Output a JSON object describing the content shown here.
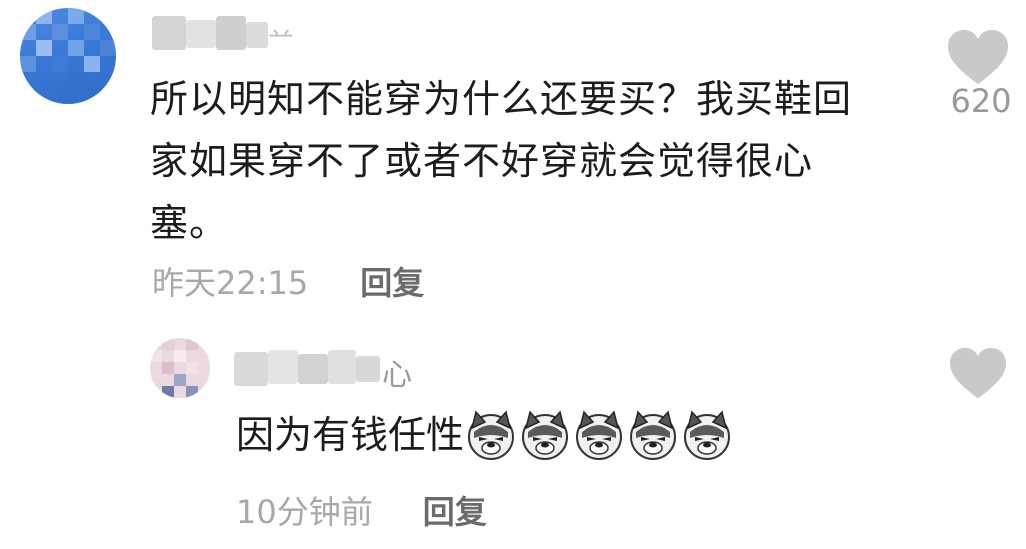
{
  "comment": {
    "username_suffix": "䒑",
    "text": "所以明知不能穿为什么还要买？我买鞋回家如果穿不了或者不好穿就会觉得很心塞。",
    "like_count": "620",
    "time": "昨天22:15",
    "reply_label": "回复"
  },
  "reply": {
    "username_suffix": "心",
    "text": "因为有钱任性",
    "emoji_count": 5,
    "emoji_name": "doge-emoji",
    "time": "10分钟前",
    "reply_label": "回复"
  },
  "colors": {
    "text_primary": "#1c1c1c",
    "text_secondary": "#a8a8a8",
    "reply_action": "#6b6b6b",
    "like_icon": "#c9c9c9",
    "avatar_main": "#3a78d6",
    "avatar_reply": "#ecd9e0"
  }
}
